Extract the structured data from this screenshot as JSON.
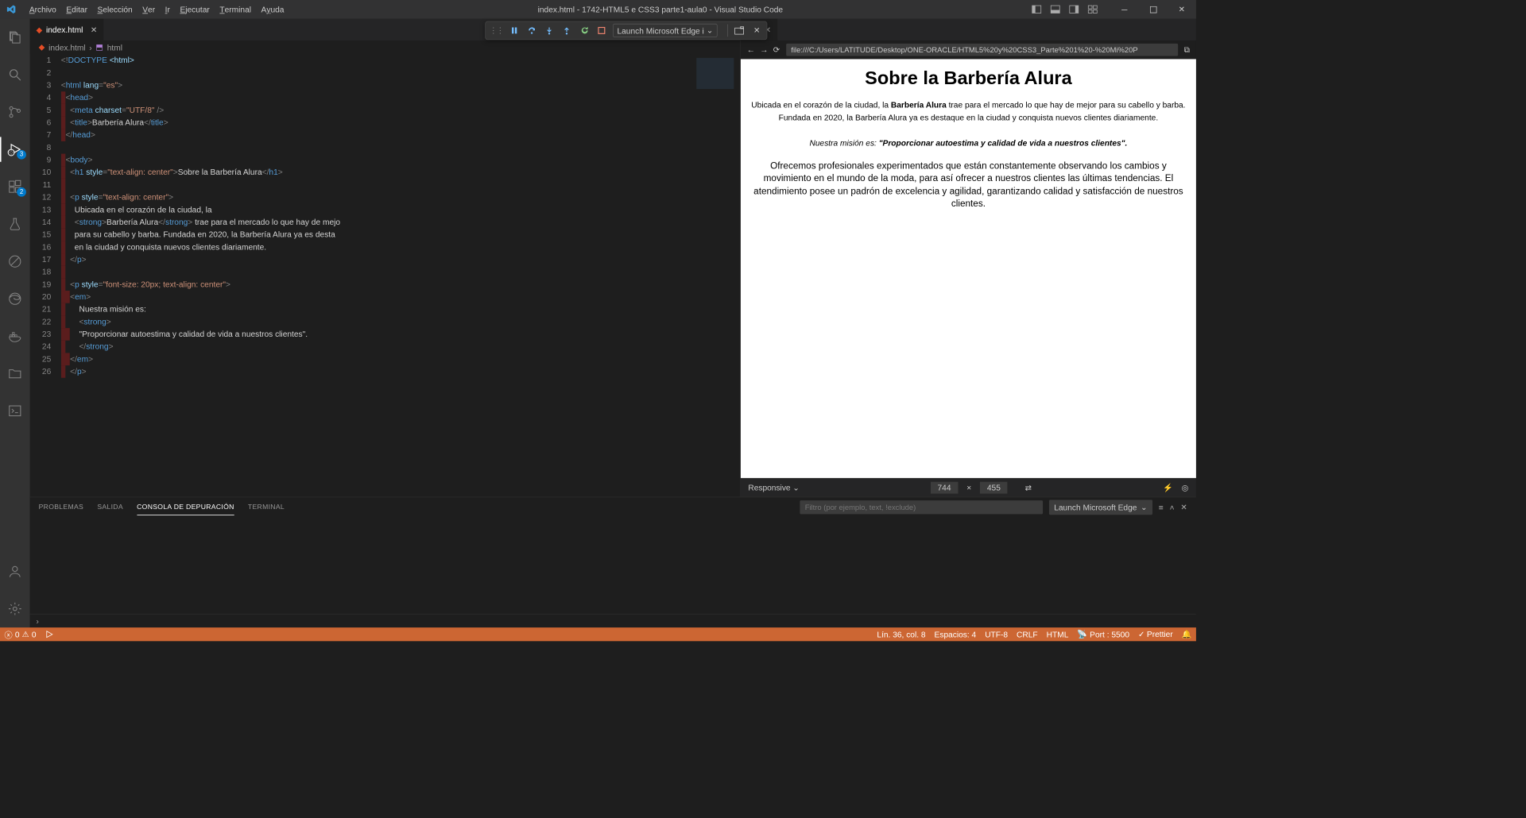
{
  "titlebar": {
    "menus": [
      "Archivo",
      "Editar",
      "Selección",
      "Ver",
      "Ir",
      "Ejecutar",
      "Terminal",
      "Ayuda"
    ],
    "menu_underline_idx": [
      0,
      0,
      0,
      0,
      0,
      0,
      0,
      1
    ],
    "title": "index.html - 1742-HTML5 e CSS3 parte1-aula0 - Visual Studio Code"
  },
  "activitybar": {
    "badge_debug": "3",
    "badge_ext": "2"
  },
  "tab": {
    "filename": "index.html"
  },
  "debug_toolbar": {
    "config": "Launch Microsoft Edge i"
  },
  "breadcrumb": {
    "file": "index.html",
    "symbol": "html"
  },
  "code_lines": [
    {
      "n": 1,
      "indent_err": 0,
      "html": "<span class='punct'>&lt;!</span><span class='doctype'>DOCTYPE</span> <span class='attr'>&lt;html&gt;</span>"
    },
    {
      "n": 2,
      "indent_err": 0,
      "html": ""
    },
    {
      "n": 3,
      "indent_err": 0,
      "html": "<span class='punct'>&lt;</span><span class='tag'>html</span> <span class='attr'>lang</span><span class='punct'>=</span><span class='str'>\"es\"</span><span class='punct'>&gt;</span>"
    },
    {
      "n": 4,
      "indent_err": 1,
      "html": "<span class='punct'>&lt;</span><span class='tag'>head</span><span class='punct'>&gt;</span>"
    },
    {
      "n": 5,
      "indent_err": 1,
      "html": "  <span class='punct'>&lt;</span><span class='tag'>meta</span> <span class='attr'>charset</span><span class='punct'>=</span><span class='str'>\"UTF/8\"</span> <span class='punct'>/&gt;</span>"
    },
    {
      "n": 6,
      "indent_err": 1,
      "html": "  <span class='punct'>&lt;</span><span class='tag'>title</span><span class='punct'>&gt;</span><span class='txt'>Barbería Alura</span><span class='punct'>&lt;/</span><span class='tag'>title</span><span class='punct'>&gt;</span>"
    },
    {
      "n": 7,
      "indent_err": 1,
      "html": "<span class='punct'>&lt;/</span><span class='tag'>head</span><span class='punct'>&gt;</span>"
    },
    {
      "n": 8,
      "indent_err": 0,
      "html": ""
    },
    {
      "n": 9,
      "indent_err": 1,
      "html": "<span class='punct'>&lt;</span><span class='tag'>body</span><span class='punct'>&gt;</span>"
    },
    {
      "n": 10,
      "indent_err": 1,
      "html": "  <span class='punct'>&lt;</span><span class='tag'>h1</span> <span class='attr'>style</span><span class='punct'>=</span><span class='str'>\"text-align: center\"</span><span class='punct'>&gt;</span><span class='txt'>Sobre la Barbería Alura</span><span class='punct'>&lt;/</span><span class='tag'>h1</span><span class='punct'>&gt;</span>"
    },
    {
      "n": 11,
      "indent_err": 1,
      "html": ""
    },
    {
      "n": 12,
      "indent_err": 1,
      "html": "  <span class='punct'>&lt;</span><span class='tag'>p</span> <span class='attr'>style</span><span class='punct'>=</span><span class='str'>\"text-align: center\"</span><span class='punct'>&gt;</span>"
    },
    {
      "n": 13,
      "indent_err": 1,
      "html": "    <span class='txt'>Ubicada en el corazón de la ciudad, la</span>"
    },
    {
      "n": 14,
      "indent_err": 1,
      "html": "    <span class='punct'>&lt;</span><span class='tag'>strong</span><span class='punct'>&gt;</span><span class='txt'>Barbería Alura</span><span class='punct'>&lt;/</span><span class='tag'>strong</span><span class='punct'>&gt;</span><span class='txt'> trae para el mercado lo que hay de mejo</span>"
    },
    {
      "n": 15,
      "indent_err": 1,
      "html": "    <span class='txt'>para su cabello y barba. Fundada en 2020, la Barbería Alura ya es desta</span>"
    },
    {
      "n": 16,
      "indent_err": 1,
      "html": "    <span class='txt'>en la ciudad y conquista nuevos clientes diariamente.</span>"
    },
    {
      "n": 17,
      "indent_err": 1,
      "html": "  <span class='punct'>&lt;/</span><span class='tag'>p</span><span class='punct'>&gt;</span>"
    },
    {
      "n": 18,
      "indent_err": 1,
      "html": ""
    },
    {
      "n": 19,
      "indent_err": 1,
      "html": "  <span class='punct'>&lt;</span><span class='tag'>p</span> <span class='attr'>style</span><span class='punct'>=</span><span class='str'>\"font-size: 20px; text-align: center\"</span><span class='punct'>&gt;</span>"
    },
    {
      "n": 20,
      "indent_err": 2,
      "html": "<span class='punct'>&lt;</span><span class='tag'>em</span><span class='punct'>&gt;</span>"
    },
    {
      "n": 21,
      "indent_err": 1,
      "html": "      <span class='txt'>Nuestra misión es:</span>"
    },
    {
      "n": 22,
      "indent_err": 1,
      "html": "      <span class='punct'>&lt;</span><span class='tag'>strong</span><span class='punct'>&gt;</span>"
    },
    {
      "n": 23,
      "indent_err": 2,
      "html": "    <span class='txt'>\"Proporcionar autoestima y calidad de vida a nuestros clientes\".</span>"
    },
    {
      "n": 24,
      "indent_err": 1,
      "html": "      <span class='punct'>&lt;/</span><span class='tag'>strong</span><span class='punct'>&gt;</span>"
    },
    {
      "n": 25,
      "indent_err": 2,
      "html": "<span class='punct'>&lt;/</span><span class='tag'>em</span><span class='punct'>&gt;</span>"
    },
    {
      "n": 26,
      "indent_err": 1,
      "html": "  <span class='punct'>&lt;/</span><span class='tag'>p</span><span class='punct'>&gt;</span>"
    }
  ],
  "preview": {
    "address": "file:///C:/Users/LATITUDE/Desktop/ONE-ORACLE/HTML5%20y%20CSS3_Parte%201%20-%20Mi%20P",
    "h1": "Sobre la Barbería Alura",
    "p1_pre": "Ubicada en el corazón de la ciudad, la ",
    "p1_strong": "Barbería Alura",
    "p1_post": " trae para el mercado lo que hay de mejor para su cabello y barba. Fundada en 2020, la Barbería Alura ya es destaque en la ciudad y conquista nuevos clientes diariamente.",
    "p2_pre": "Nuestra misión es: ",
    "p2_strong": "\"Proporcionar autoestima y calidad de vida a nuestros clientes\".",
    "p3": "Ofrecemos profesionales experimentados que están constantemente observando los cambios y movimiento en el mundo de la moda, para así ofrecer a nuestros clientes las últimas tendencias. El atendimiento posee un padrón de excelencia y agilidad, garantizando calidad y satisfacción de nuestros clientes.",
    "device": "Responsive",
    "width": "744",
    "height": "455"
  },
  "panel": {
    "tabs": [
      "PROBLEMAS",
      "SALIDA",
      "CONSOLA DE DEPURACIÓN",
      "TERMINAL"
    ],
    "active": 2,
    "filter_placeholder": "Filtro (por ejemplo, text, !exclude)",
    "launch": "Launch Microsoft Edge",
    "crumb": "›"
  },
  "status": {
    "errors": "0",
    "warnings": "0",
    "ln_col": "Lín. 36, col. 8",
    "spaces": "Espacios: 4",
    "encoding": "UTF-8",
    "eol": "CRLF",
    "lang": "HTML",
    "port": "Port : 5500",
    "prettier": "Prettier"
  }
}
